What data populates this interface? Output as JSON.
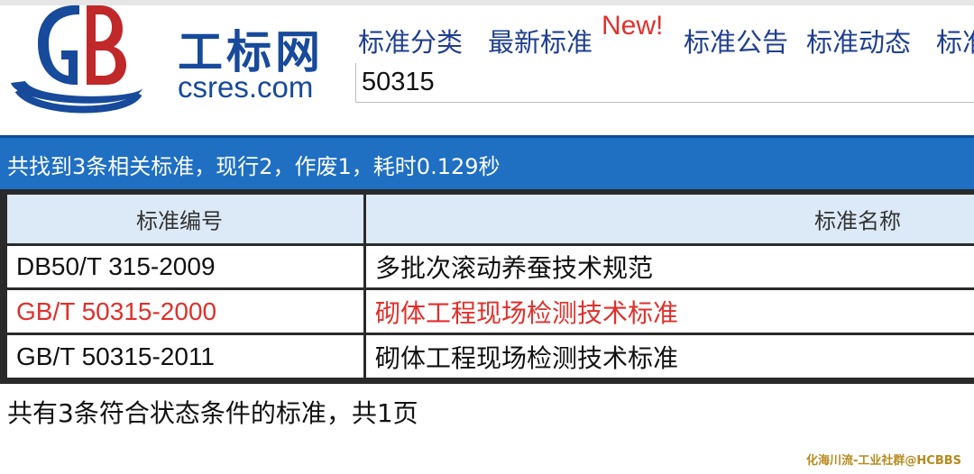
{
  "header": {
    "logo": {
      "mark_text": "GB",
      "name_cn": "工标网",
      "name_en": "csres.com"
    },
    "nav": [
      {
        "label": "标准分类"
      },
      {
        "label": "最新标准",
        "badge": "New!"
      },
      {
        "label": "标准公告"
      },
      {
        "label": "标准动态"
      },
      {
        "label": "标准"
      }
    ],
    "search": {
      "value": "50315"
    }
  },
  "results": {
    "summary": "共找到3条相关标准，现行2，作废1，耗时0.129秒"
  },
  "table": {
    "columns": [
      "标准编号",
      "标准名称"
    ],
    "rows": [
      {
        "code": "DB50/T 315-2009",
        "name": "多批次滚动养蚕技术规范",
        "status": "current"
      },
      {
        "code": "GB/T 50315-2000",
        "name": "砌体工程现场检测技术标准",
        "status": "obsolete"
      },
      {
        "code": "GB/T 50315-2011",
        "name": "砌体工程现场检测技术标准",
        "status": "current"
      }
    ]
  },
  "footer": {
    "summary": "共有3条符合状态条件的标准，共1页",
    "watermark": "化海川流-工业社群@HCBBS"
  },
  "colors": {
    "brand_blue": "#174a9b",
    "bar_blue": "#1f6fc3",
    "obsolete_red": "#e0302b",
    "header_cell": "#dce9f7"
  }
}
